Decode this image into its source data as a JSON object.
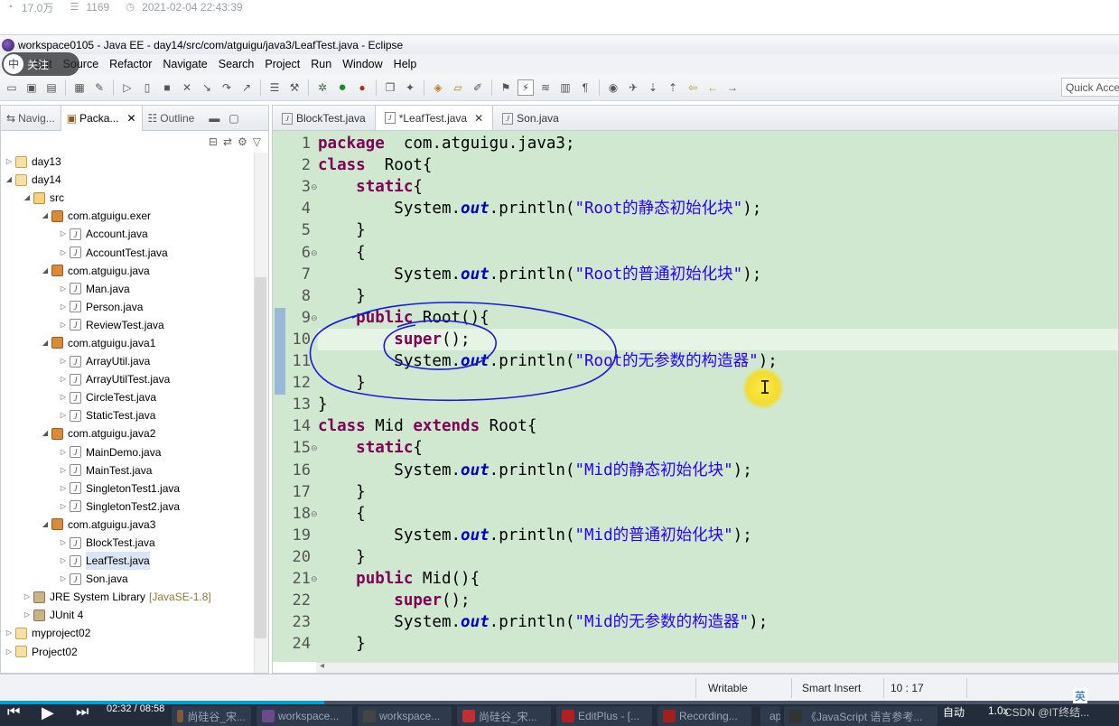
{
  "article_meta": {
    "views": "17.0万",
    "words": "1169",
    "datetime": "2021-02-04 22:43:39"
  },
  "window": {
    "title": "workspace0105 - Java EE - day14/src/com/atguigu/java3/LeafTest.java - Eclipse"
  },
  "follow_badge": {
    "avatar_text": "中",
    "label": "关注"
  },
  "menu": [
    "Edit",
    "Source",
    "Refactor",
    "Navigate",
    "Search",
    "Project",
    "Run",
    "Window",
    "Help"
  ],
  "quick_access": {
    "placeholder": "Quick Access"
  },
  "left_panel": {
    "tabs": [
      {
        "label": "Navig..."
      },
      {
        "label": "Packa..."
      },
      {
        "label": "Outline"
      }
    ],
    "tree": [
      {
        "label": "day13",
        "depth": 0,
        "icon": "project-icon",
        "expanded": false
      },
      {
        "label": "day14",
        "depth": 0,
        "icon": "project-icon",
        "expanded": true
      },
      {
        "label": "src",
        "depth": 1,
        "icon": "source-folder-icon",
        "expanded": true
      },
      {
        "label": "com.atguigu.exer",
        "depth": 2,
        "icon": "package-icon",
        "expanded": true
      },
      {
        "label": "Account.java",
        "depth": 3,
        "icon": "java-file-icon",
        "expanded": false
      },
      {
        "label": "AccountTest.java",
        "depth": 3,
        "icon": "java-file-icon",
        "expanded": false
      },
      {
        "label": "com.atguigu.java",
        "depth": 2,
        "icon": "package-icon",
        "expanded": true
      },
      {
        "label": "Man.java",
        "depth": 3,
        "icon": "java-file-icon",
        "expanded": false
      },
      {
        "label": "Person.java",
        "depth": 3,
        "icon": "java-file-icon",
        "expanded": false
      },
      {
        "label": "ReviewTest.java",
        "depth": 3,
        "icon": "java-file-icon",
        "expanded": false
      },
      {
        "label": "com.atguigu.java1",
        "depth": 2,
        "icon": "package-icon",
        "expanded": true
      },
      {
        "label": "ArrayUtil.java",
        "depth": 3,
        "icon": "java-file-icon",
        "expanded": false
      },
      {
        "label": "ArrayUtilTest.java",
        "depth": 3,
        "icon": "java-file-icon",
        "expanded": false
      },
      {
        "label": "CircleTest.java",
        "depth": 3,
        "icon": "java-file-icon",
        "expanded": false
      },
      {
        "label": "StaticTest.java",
        "depth": 3,
        "icon": "java-file-icon",
        "expanded": false
      },
      {
        "label": "com.atguigu.java2",
        "depth": 2,
        "icon": "package-icon",
        "expanded": true
      },
      {
        "label": "MainDemo.java",
        "depth": 3,
        "icon": "java-file-icon",
        "expanded": false
      },
      {
        "label": "MainTest.java",
        "depth": 3,
        "icon": "java-file-icon",
        "expanded": false
      },
      {
        "label": "SingletonTest1.java",
        "depth": 3,
        "icon": "java-file-icon",
        "expanded": false
      },
      {
        "label": "SingletonTest2.java",
        "depth": 3,
        "icon": "java-file-icon",
        "expanded": false
      },
      {
        "label": "com.atguigu.java3",
        "depth": 2,
        "icon": "package-icon",
        "expanded": true
      },
      {
        "label": "BlockTest.java",
        "depth": 3,
        "icon": "java-file-icon",
        "expanded": false
      },
      {
        "label": "LeafTest.java",
        "depth": 3,
        "icon": "java-file-icon",
        "expanded": false,
        "selected": true
      },
      {
        "label": "Son.java",
        "depth": 3,
        "icon": "java-file-icon",
        "expanded": false
      },
      {
        "label": "JRE System Library",
        "suffix": "[JavaSE-1.8]",
        "depth": 1,
        "icon": "library-icon",
        "expanded": false
      },
      {
        "label": "JUnit 4",
        "depth": 1,
        "icon": "library-icon",
        "expanded": false
      },
      {
        "label": "myproject02",
        "depth": 0,
        "icon": "project-icon",
        "expanded": false
      },
      {
        "label": "Project02",
        "depth": 0,
        "icon": "project-icon",
        "expanded": false
      }
    ]
  },
  "editor": {
    "tabs": [
      {
        "label": "BlockTest.java"
      },
      {
        "label": "*LeafTest.java",
        "active": true
      },
      {
        "label": "Son.java"
      }
    ],
    "current_line": 10,
    "lines": [
      [
        [
          "kw",
          "package"
        ],
        [
          "",
          "  com.atguigu.java3;"
        ]
      ],
      [
        [
          "kw",
          "class"
        ],
        [
          "",
          "  Root{"
        ]
      ],
      [
        [
          "",
          "    "
        ],
        [
          "kw",
          "static"
        ],
        [
          "",
          "{"
        ]
      ],
      [
        [
          "",
          "        System."
        ],
        [
          "fld",
          "out"
        ],
        [
          "",
          ".println("
        ],
        [
          "str",
          "\"Root的静态初始化块\""
        ],
        [
          "",
          ");"
        ]
      ],
      [
        [
          "",
          "    }"
        ]
      ],
      [
        [
          "",
          "    {"
        ]
      ],
      [
        [
          "",
          "        System."
        ],
        [
          "fld",
          "out"
        ],
        [
          "",
          ".println("
        ],
        [
          "str",
          "\"Root的普通初始化块\""
        ],
        [
          "",
          ");"
        ]
      ],
      [
        [
          "",
          "    }"
        ]
      ],
      [
        [
          "",
          "    "
        ],
        [
          "kw",
          "public"
        ],
        [
          "",
          " Root(){"
        ]
      ],
      [
        [
          "",
          "        "
        ],
        [
          "kw",
          "super"
        ],
        [
          "",
          "();"
        ]
      ],
      [
        [
          "",
          "        System."
        ],
        [
          "fld",
          "out"
        ],
        [
          "",
          ".println("
        ],
        [
          "str",
          "\"Root的无参数的构造器\""
        ],
        [
          "",
          ");"
        ]
      ],
      [
        [
          "",
          "    }"
        ]
      ],
      [
        [
          "",
          "}"
        ]
      ],
      [
        [
          "kw",
          "class"
        ],
        [
          "",
          " Mid "
        ],
        [
          "kw",
          "extends"
        ],
        [
          "",
          " Root{"
        ]
      ],
      [
        [
          "",
          "    "
        ],
        [
          "kw",
          "static"
        ],
        [
          "",
          "{"
        ]
      ],
      [
        [
          "",
          "        System."
        ],
        [
          "fld",
          "out"
        ],
        [
          "",
          ".println("
        ],
        [
          "str",
          "\"Mid的静态初始化块\""
        ],
        [
          "",
          ");"
        ]
      ],
      [
        [
          "",
          "    }"
        ]
      ],
      [
        [
          "",
          "    {"
        ]
      ],
      [
        [
          "",
          "        System."
        ],
        [
          "fld",
          "out"
        ],
        [
          "",
          ".println("
        ],
        [
          "str",
          "\"Mid的普通初始化块\""
        ],
        [
          "",
          ");"
        ]
      ],
      [
        [
          "",
          "    }"
        ]
      ],
      [
        [
          "",
          "    "
        ],
        [
          "kw",
          "public"
        ],
        [
          "",
          " Mid(){"
        ]
      ],
      [
        [
          "",
          "        "
        ],
        [
          "kw",
          "super"
        ],
        [
          "",
          "();"
        ]
      ],
      [
        [
          "",
          "        System."
        ],
        [
          "fld",
          "out"
        ],
        [
          "",
          ".println("
        ],
        [
          "str",
          "\"Mid的无参数的构造器\""
        ],
        [
          "",
          ");"
        ]
      ],
      [
        [
          "",
          "    }"
        ]
      ]
    ],
    "fold_lines": [
      3,
      6,
      9,
      15,
      18,
      21
    ]
  },
  "status": {
    "mode": "Writable",
    "insert": "Smart Insert",
    "position": "10 : 17"
  },
  "video": {
    "time": "02:32 / 08:58",
    "played_fraction": 0.29
  },
  "taskbar": {
    "items": [
      {
        "label": "尚硅谷_宋..."
      },
      {
        "label": "workspace..."
      },
      {
        "label": "workspace..."
      },
      {
        "label": "尚硅谷_宋..."
      },
      {
        "label": "EditPlus - [..."
      },
      {
        "label": "Recording..."
      },
      {
        "label": "api"
      },
      {
        "label": "《JavaScript 语言参考..."
      }
    ],
    "tray": {
      "auto": "自动",
      "speed": "1.0x",
      "watermark": "CSDN @IT终结...",
      "ime": "英"
    }
  },
  "colors": {
    "editor_bg": "#cfe8cf",
    "keyword": "#7f0055",
    "string": "#2a00ff",
    "field": "#0000c0",
    "annotation_ink": "#1a1ad8",
    "cursor_highlight": "#f3dc2d"
  }
}
